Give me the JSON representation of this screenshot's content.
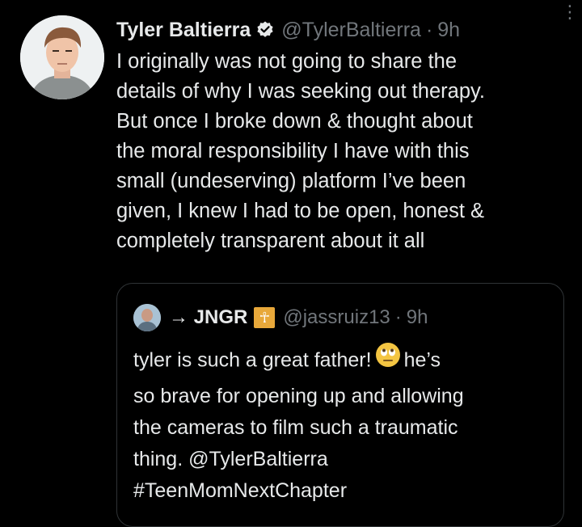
{
  "tweet": {
    "display_name": "Tyler Baltierra",
    "handle": "@TylerBaltierra",
    "dot": "·",
    "time": "9h",
    "more": "⋮",
    "lines": [
      "I originally was not going to share the",
      "details of why I was seeking out therapy.",
      "But once I broke down & thought about",
      "the moral responsibility I have with this",
      "small (undeserving) platform I’ve been",
      "given, I knew I had to be open, honest &",
      "completely transparent about it all"
    ]
  },
  "quote": {
    "display_name": "→ JNGR",
    "badge": "☥",
    "handle": "@jassruiz13",
    "dot": "·",
    "time": "9h",
    "line1_before": "tyler is such a great father!",
    "line1_after": "he’s",
    "lines": [
      "so brave for opening up and allowing",
      "the cameras to film such a traumatic",
      "thing. @TylerBaltierra",
      "#TeenMomNextChapter"
    ]
  },
  "colors": {
    "background": "#000000",
    "text": "#e7e9ea",
    "secondary": "#71767b",
    "border": "#2f3336",
    "verified_badge": "#e7e9ea",
    "emoji": "#f4c542"
  }
}
